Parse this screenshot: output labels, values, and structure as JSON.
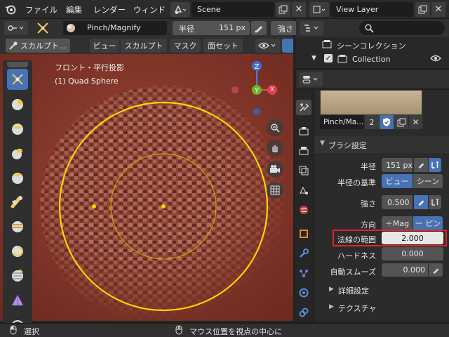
{
  "topbar": {
    "menus": [
      "ファイル",
      "編集",
      "レンダー",
      "ウィンド"
    ],
    "scene": "Scene",
    "view_layer": "View Layer"
  },
  "tool_header": {
    "brush_name": "Pinch/Magnify",
    "radius_label": "半径",
    "radius_value": "151 px",
    "strength_label": "強さ"
  },
  "viewport_header": {
    "mode": "スカルプト...",
    "menus": [
      "ビュー",
      "スカルプト",
      "マスク",
      "面セット"
    ]
  },
  "viewport": {
    "view_name": "フロント・平行投影",
    "object_name": "(1) Quad Sphere",
    "gizmo": {
      "z": "Z",
      "y": "Y",
      "x": "X"
    }
  },
  "outliner": {
    "scene_collection": "シーンコレクション",
    "collection": "Collection"
  },
  "properties": {
    "brush_name": "Pinch/Ma...",
    "user_count": "2",
    "section_brush": "ブラシ設定",
    "rows": {
      "radius_label": "半径",
      "radius_value": "151 px",
      "radius_unit_label": "半径の基準",
      "view_option": "ビュー",
      "scene_option": "シーン",
      "strength_label": "強さ",
      "strength_value": "0.500",
      "direction_label": "方向",
      "dir_mag": "＋Mag",
      "dir_pinch": "ー ピン",
      "normal_radius_label": "法線の範囲",
      "normal_radius_value": "2.000",
      "hardness_label": "ハードネス",
      "hardness_value": "0.000",
      "autosmooth_label": "自動スムーズ",
      "autosmooth_value": "0.000"
    },
    "subpanels": [
      "詳細設定",
      "テクスチャ"
    ]
  },
  "statusbar": {
    "select": "選択",
    "center": "マウス位置を視点の中心に"
  },
  "colors": {
    "accent": "#4772b3",
    "highlight_box": "#e8202a",
    "brush_circle": "#ffd400",
    "viewport_bg": "#8b3a2c"
  }
}
